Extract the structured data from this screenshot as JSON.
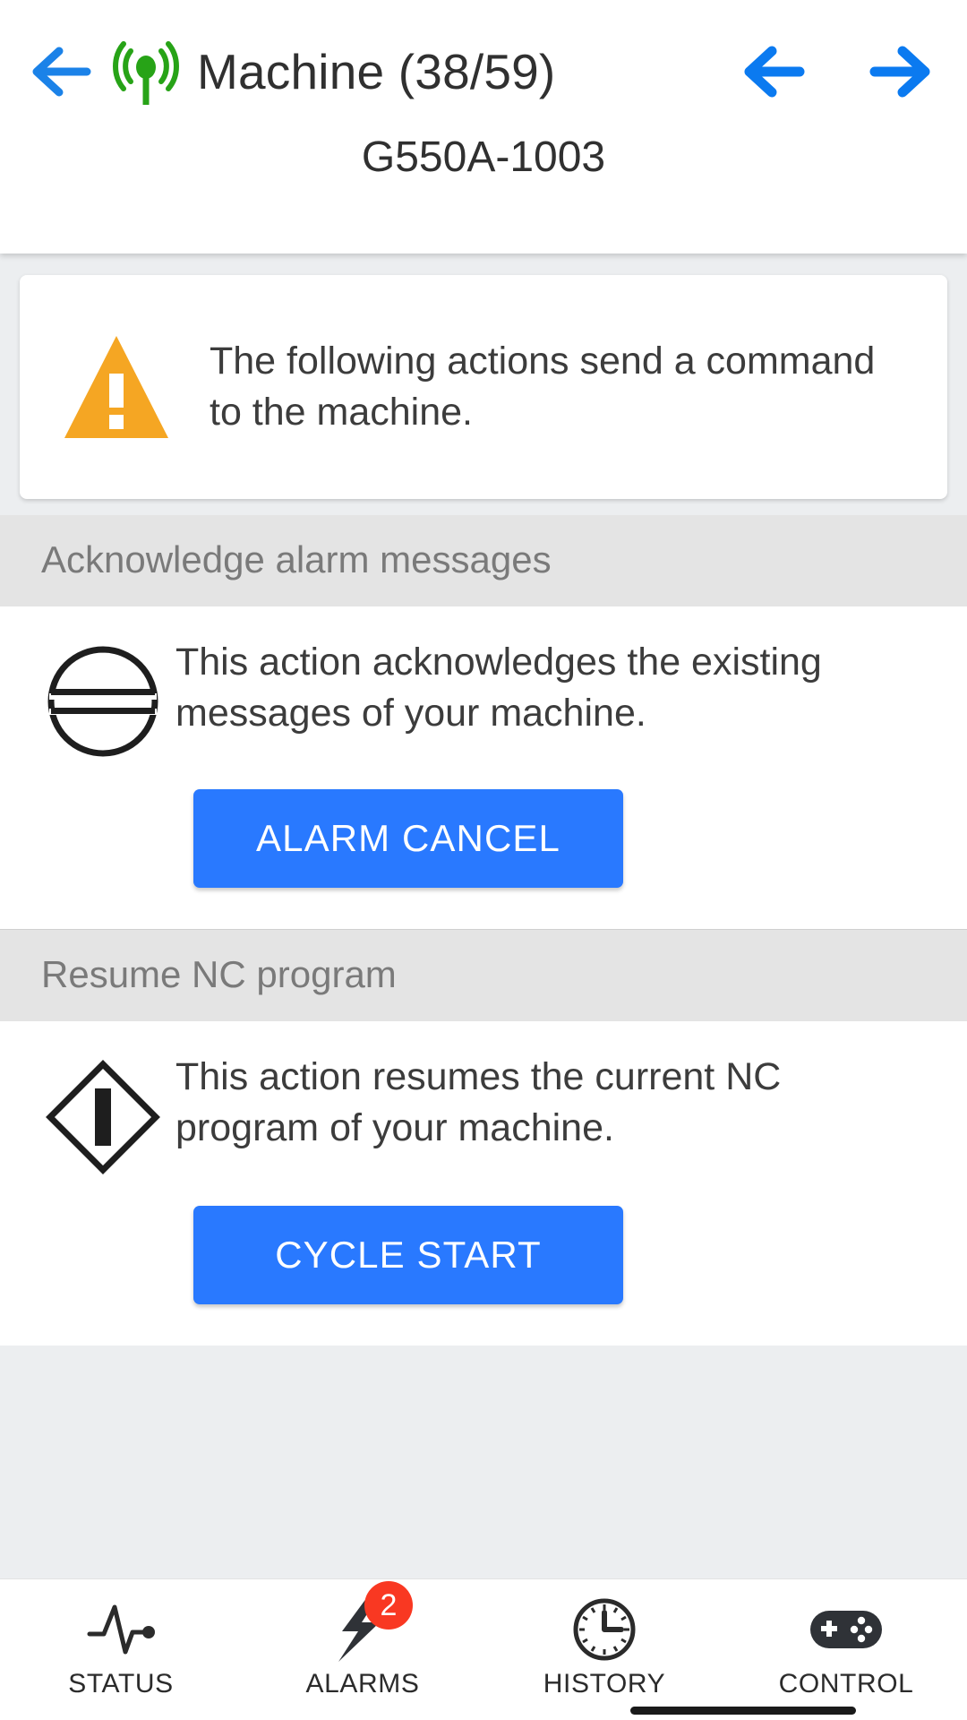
{
  "header": {
    "back_icon": "arrow-left-icon",
    "broadcast_icon": "broadcast-antenna-icon",
    "title": "Machine (38/59)",
    "prev_icon": "arrow-left-icon",
    "next_icon": "arrow-right-icon",
    "subtitle": "G550A-1003",
    "accent_blue": "#1B82E8",
    "antenna_green": "#27A317"
  },
  "warning": {
    "icon": "warning-triangle-icon",
    "icon_color": "#F5A623",
    "text": "The following actions send a command to the machine."
  },
  "sections": [
    {
      "heading": "Acknowledge alarm messages",
      "icon": "alarm-cancel-circle-icon",
      "description": "This action acknowledges the existing messages of your machine.",
      "button_label": "ALARM CANCEL",
      "button_color": "#2979FF"
    },
    {
      "heading": "Resume NC program",
      "icon": "cycle-start-diamond-icon",
      "description": "This action resumes the current NC program of your machine.",
      "button_label": "CYCLE START",
      "button_color": "#2979FF"
    }
  ],
  "bottom_nav": {
    "tabs": [
      {
        "label": "STATUS",
        "icon": "pulse-heartbeat-icon",
        "badge": ""
      },
      {
        "label": "ALARMS",
        "icon": "lightning-bolt-icon",
        "badge": "2"
      },
      {
        "label": "HISTORY",
        "icon": "clock-icon",
        "badge": ""
      },
      {
        "label": "CONTROL",
        "icon": "gamepad-icon",
        "badge": ""
      }
    ],
    "badge_color": "#F93822",
    "active_tab": "CONTROL"
  }
}
